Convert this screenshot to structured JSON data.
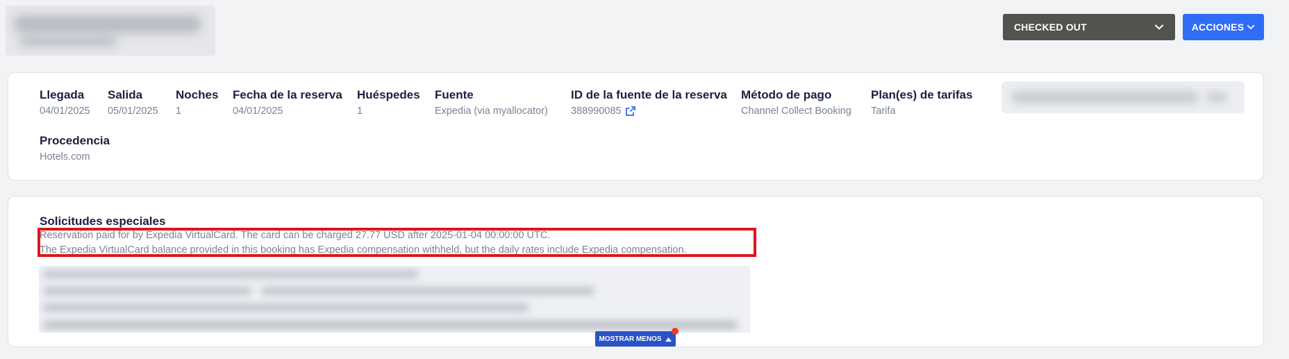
{
  "header": {
    "status": {
      "value": "CHECKED OUT",
      "icon": "chevron-down-icon"
    },
    "actions": {
      "label": "ACCIONES",
      "icon": "chevron-down-icon"
    }
  },
  "details": {
    "arrival": {
      "label": "Llegada",
      "value": "04/01/2025"
    },
    "departure": {
      "label": "Salida",
      "value": "05/01/2025"
    },
    "nights": {
      "label": "Noches",
      "value": "1"
    },
    "booking_date": {
      "label": "Fecha de la reserva",
      "value": "04/01/2025"
    },
    "guests": {
      "label": "Huéspedes",
      "value": "1"
    },
    "source": {
      "label": "Fuente",
      "value": "Expedia (via myallocator)"
    },
    "source_id": {
      "label": "ID de la fuente de la reserva",
      "value": "388990085",
      "icon": "external-link-icon"
    },
    "payment_method": {
      "label": "Método de pago",
      "value": "Channel Collect Booking"
    },
    "rate_plans": {
      "label": "Plan(es) de tarifas",
      "value": "Tarifa"
    },
    "origin": {
      "label": "Procedencia",
      "value": "Hotels.com"
    }
  },
  "special_requests": {
    "title": "Solicitudes especiales",
    "lines": [
      "Reservation paid for by Expedia VirtualCard. The card can be charged 27.77 USD after 2025-01-04 00:00:00 UTC.",
      "The Expedia VirtualCard balance provided in this booking has Expedia compensation withheld, but the daily rates include Expedia compensation."
    ]
  },
  "show_less": {
    "label": "MOSTRAR MENOS",
    "icon": "caret-up-icon"
  },
  "colors": {
    "accent": "#2f6df6",
    "status_bg": "#52524f",
    "highlight": "#e0141c",
    "show_less_bg": "#2853c6",
    "notification": "#ee3b2f"
  }
}
